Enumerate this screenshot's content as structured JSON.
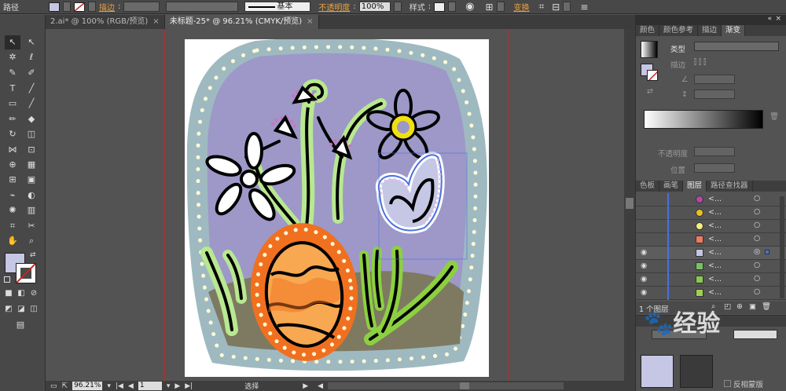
{
  "control_bar": {
    "object_type": "路径",
    "stroke_label": "描边",
    "brush_name": "基本",
    "opacity_label": "不透明度",
    "opacity_value": "100%",
    "style_label": "样式",
    "transform_label": "变换"
  },
  "document_tabs": [
    {
      "label": "2.ai* @ 100% (RGB/预览)",
      "active": false
    },
    {
      "label": "未标题-25* @ 96.21% (CMYK/预览)",
      "active": true
    }
  ],
  "status_bar": {
    "zoom": "96.21%",
    "artboard": "1",
    "tool": "选择"
  },
  "gradient_panel": {
    "tabs": [
      "颜色",
      "颜色参考",
      "描边",
      "渐变"
    ],
    "type_label": "类型",
    "stroke_label": "描边",
    "opacity_label": "不透明度",
    "position_label": "位置"
  },
  "layers_panel": {
    "tabs": [
      "色板",
      "画笔",
      "图层",
      "路径查找器"
    ],
    "item_label": "<...",
    "footer_text": "1 个图层",
    "bottom_label": "反相蒙版",
    "row_colors": [
      "#b04aa0",
      "#e8c020",
      "#f4f080",
      "#f07a60",
      "#c5c7e4",
      "#78c060",
      "#8ac850",
      "#a0d050"
    ]
  },
  "colors": {
    "panel_bg": "#535353",
    "dark_bar": "#484848",
    "fill_swatch": "#c5c7e4",
    "accent": "#e8a040",
    "selection": "#4a70e0"
  },
  "watermark": "经验"
}
